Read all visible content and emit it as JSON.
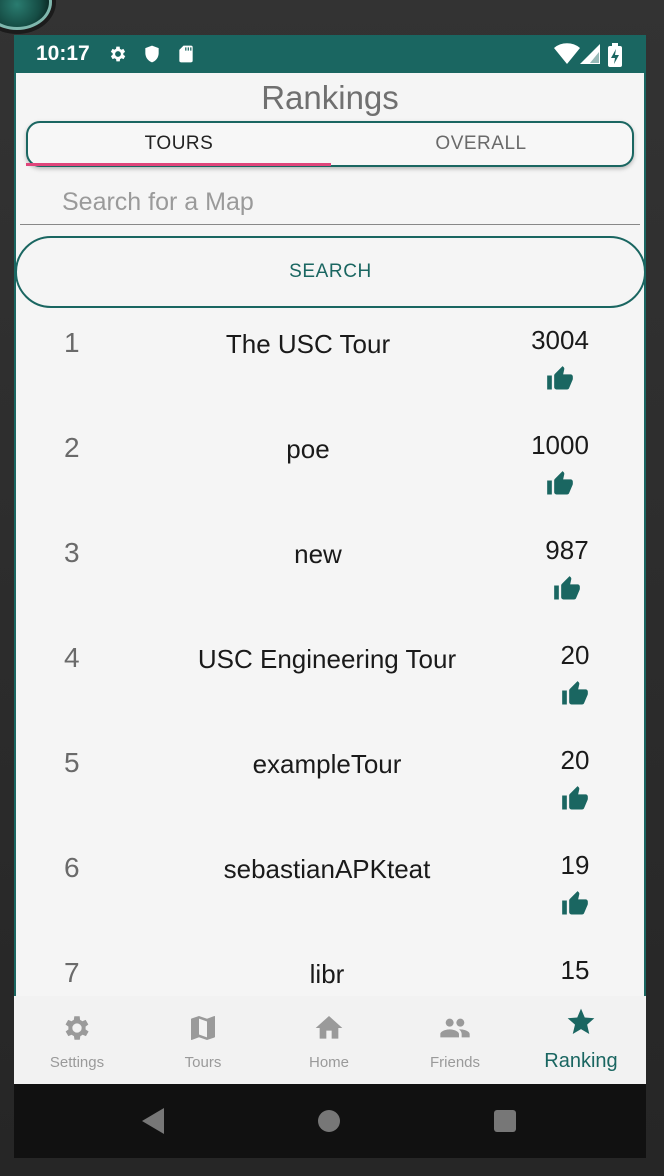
{
  "status_bar": {
    "time": "10:17",
    "icons_left": [
      "gear-icon",
      "shield-icon",
      "sd-card-icon"
    ],
    "icons_right": [
      "wifi-icon",
      "cell-signal-icon",
      "battery-charging-icon"
    ]
  },
  "page": {
    "title": "Rankings"
  },
  "tabs": [
    {
      "label": "TOURS",
      "selected": true
    },
    {
      "label": "OVERALL",
      "selected": false
    }
  ],
  "search": {
    "placeholder": "Search for a Map",
    "value": "",
    "button_label": "SEARCH"
  },
  "rankings": [
    {
      "rank": "1",
      "name": "The USC Tour",
      "likes": "3004"
    },
    {
      "rank": "2",
      "name": "poe",
      "likes": "1000"
    },
    {
      "rank": "3",
      "name": "new",
      "likes": "987"
    },
    {
      "rank": "4",
      "name": "USC Engineering Tour",
      "likes": "20"
    },
    {
      "rank": "5",
      "name": "exampleTour",
      "likes": "20"
    },
    {
      "rank": "6",
      "name": "sebastianAPKteat",
      "likes": "19"
    },
    {
      "rank": "7",
      "name": "libr",
      "likes": "15"
    }
  ],
  "bottom_nav": [
    {
      "label": "Settings",
      "icon": "gear-icon",
      "active": false
    },
    {
      "label": "Tours",
      "icon": "map-icon",
      "active": false
    },
    {
      "label": "Home",
      "icon": "home-icon",
      "active": false
    },
    {
      "label": "Friends",
      "icon": "people-icon",
      "active": false
    },
    {
      "label": "Ranking",
      "icon": "star-icon",
      "active": true
    }
  ],
  "colors": {
    "primary": "#1a6661",
    "tab_indicator": "#e0457b",
    "background": "#f5f5f5",
    "inactive_nav": "#9a9a9a"
  }
}
